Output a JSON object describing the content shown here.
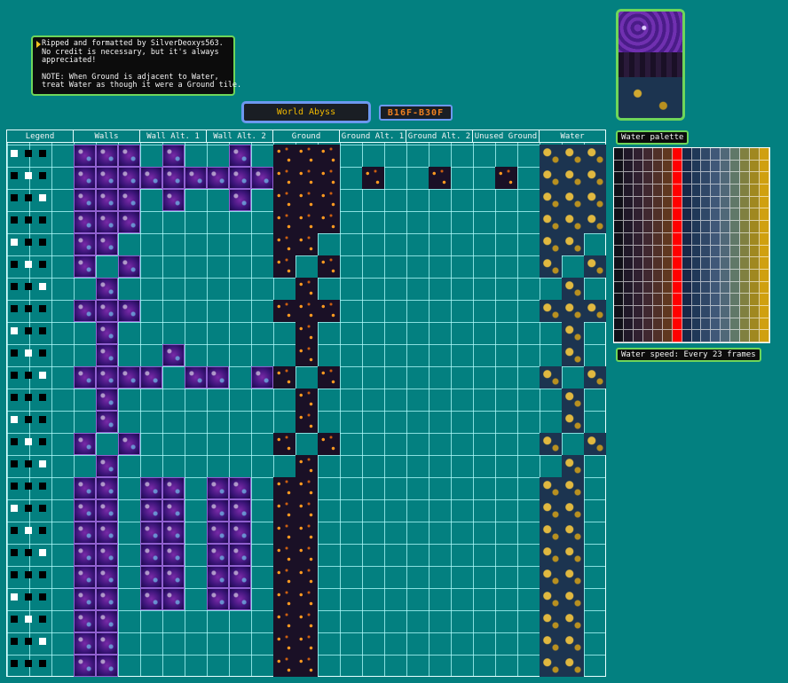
{
  "credits": {
    "line1": "Ripped and formatted by SilverDeoxys563.",
    "line2": "No credit is necessary, but it's always",
    "line3": "appreciated!",
    "note1": "NOTE: When Ground is adjacent to Water,",
    "note2": "treat Water as though it were a Ground tile."
  },
  "dungeon": {
    "name": "World Abyss",
    "floors": "B16F-B30F"
  },
  "columns": [
    "Legend",
    "Walls",
    "Wall Alt. 1",
    "Wall Alt. 2",
    "Ground",
    "Ground Alt. 1",
    "Ground Alt. 2",
    "Unused Ground",
    "Water"
  ],
  "sidebar": {
    "palette_label": "Water palette",
    "speed_label": "Water speed: Every 23 frames",
    "palette_colors": [
      "#101018",
      "#201828",
      "#302030",
      "#402830",
      "#503028",
      "#603820",
      "#ff0000",
      "#182848",
      "#203858",
      "#304868",
      "#405878",
      "#506878",
      "#607868",
      "#808040",
      "#a08820",
      "#d0a010"
    ]
  }
}
